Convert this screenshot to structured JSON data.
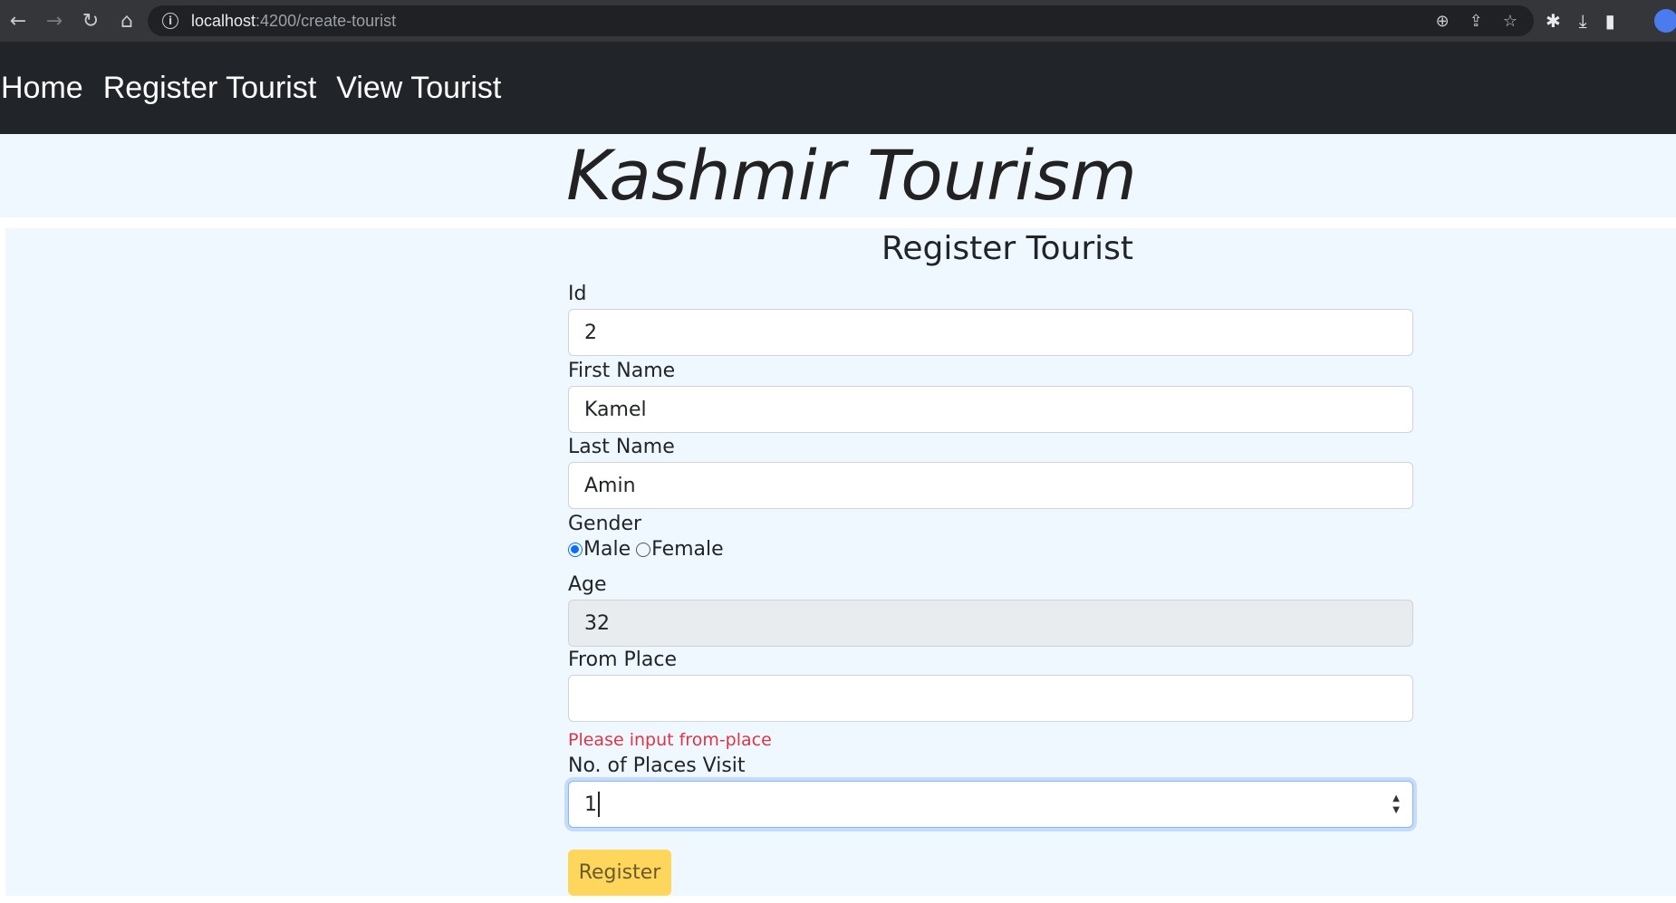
{
  "browser": {
    "url_host": "localhost",
    "url_path": ":4200/create-tourist"
  },
  "navbar": {
    "items": [
      "Home",
      "Register Tourist",
      "View Tourist"
    ]
  },
  "banner": {
    "title": "Kashmir Tourism"
  },
  "form": {
    "title": "Register Tourist",
    "id": {
      "label": "Id",
      "value": "2"
    },
    "first_name": {
      "label": "First Name",
      "value": "Kamel"
    },
    "last_name": {
      "label": "Last Name",
      "value": "Amin"
    },
    "gender": {
      "label": "Gender",
      "options": [
        "Male",
        "Female"
      ],
      "selected": "Male"
    },
    "age": {
      "label": "Age",
      "value": "32"
    },
    "from_place": {
      "label": "From Place",
      "value": "",
      "error": "Please input from-place"
    },
    "places_visit": {
      "label": "No. of Places Visit",
      "value": "1"
    },
    "submit_label": "Register"
  },
  "colors": {
    "navbar": "#212529",
    "page_bg": "#f0f8ff",
    "button": "#ffd65c",
    "error": "#dc3545",
    "focus_border": "#86b7fe"
  }
}
